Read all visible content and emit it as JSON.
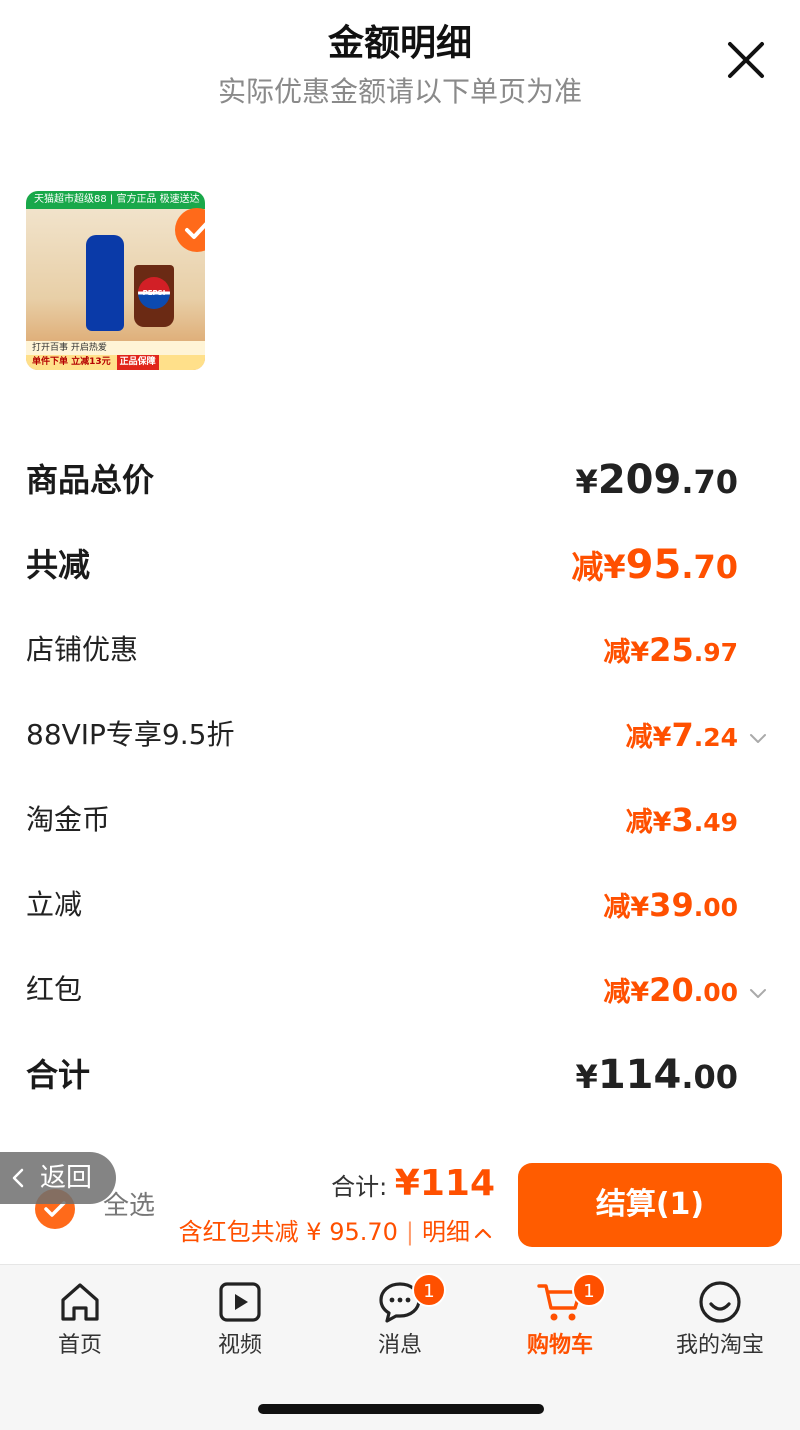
{
  "header": {
    "title": "金额明细",
    "subtitle": "实际优惠金额请以下单页为准"
  },
  "product": {
    "banner_text": "天猫超市超级88 | 官方正品 极速送达",
    "pepsi_text": "PEPSI",
    "promo_line1": "打开百事 开启热爱",
    "promo_line2": "单件下单 立减13元",
    "guarantee": "正品保障"
  },
  "rows": {
    "goods_total": {
      "label": "商品总价",
      "currency": "¥",
      "main": "209",
      "dec": ".70"
    },
    "total_reduction": {
      "label": "共减",
      "prefix": "减¥",
      "main": "95",
      "dec": ".70"
    },
    "shop_discount": {
      "label": "店铺优惠",
      "prefix": "减¥",
      "main": "25",
      "dec": ".97"
    },
    "vip_discount": {
      "label": "88VIP专享9.5折",
      "prefix": "减¥",
      "main": "7",
      "dec": ".24"
    },
    "tao_coins": {
      "label": "淘金币",
      "prefix": "减¥",
      "main": "3",
      "dec": ".49"
    },
    "instant_reduction": {
      "label": "立减",
      "prefix": "减¥",
      "main": "39",
      "dec": ".00"
    },
    "red_packet": {
      "label": "红包",
      "prefix": "减¥",
      "main": "20",
      "dec": ".00"
    },
    "sum": {
      "label": "合计",
      "currency": "¥",
      "main": "114",
      "dec": ".00"
    }
  },
  "bottom": {
    "back_label": "返回",
    "select_all": "全选",
    "total_label": "合计: ",
    "total_value": "¥114",
    "discount_text": "含红包共减 ¥ 95.70",
    "separator": "|",
    "detail_link": "明细",
    "checkout_label": "结算(1)"
  },
  "tabs": [
    {
      "label": "首页",
      "icon": "home-icon"
    },
    {
      "label": "视频",
      "icon": "video-icon"
    },
    {
      "label": "消息",
      "icon": "message-icon",
      "badge": "1"
    },
    {
      "label": "购物车",
      "icon": "cart-icon",
      "badge": "1",
      "active": true
    },
    {
      "label": "我的淘宝",
      "icon": "profile-icon"
    }
  ],
  "colors": {
    "accent": "#ff5000",
    "checkout_bg": "#ff5c00"
  }
}
